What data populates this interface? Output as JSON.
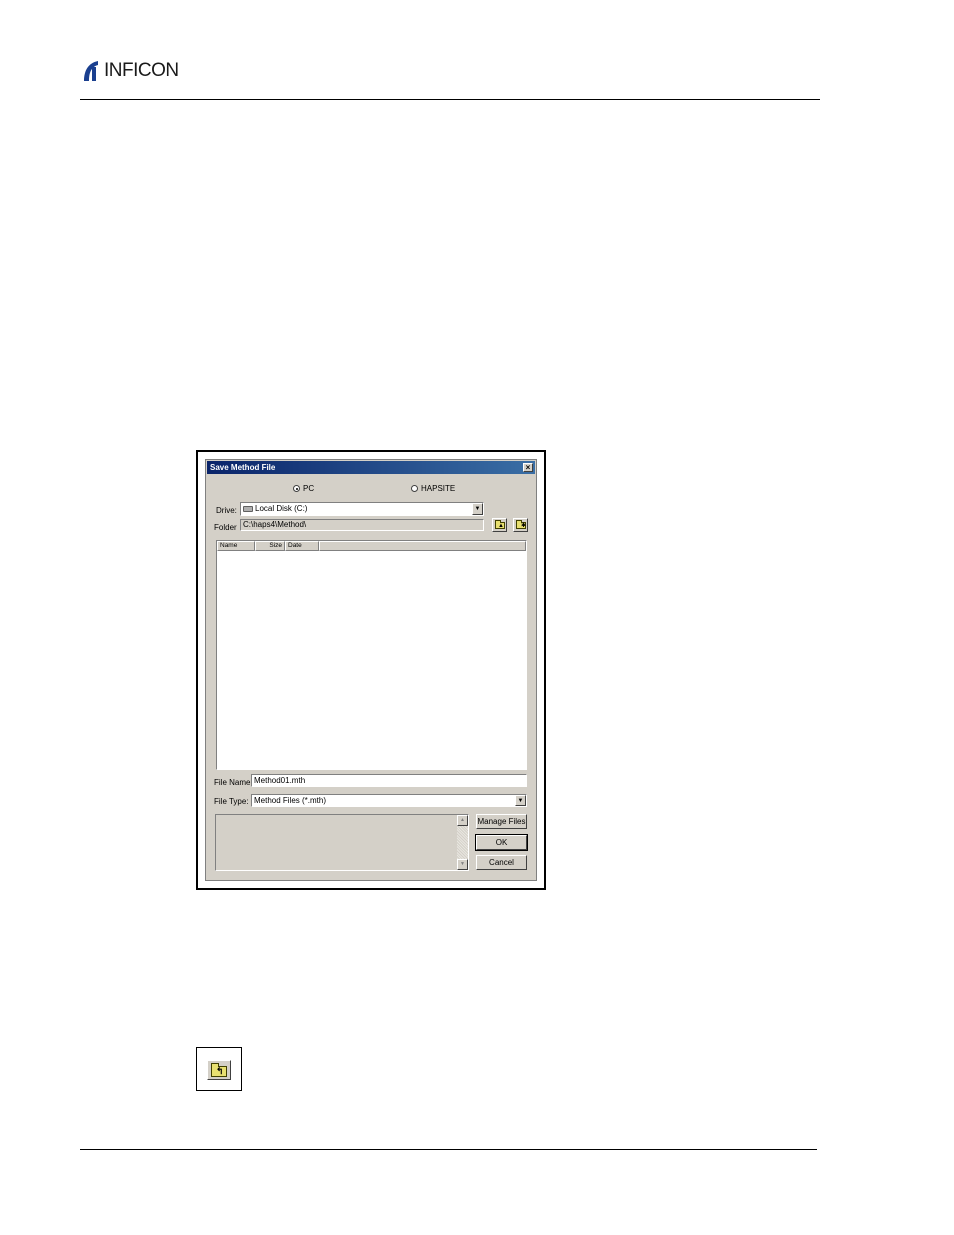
{
  "header": {
    "brand": "INFICON"
  },
  "dialog": {
    "title": "Save Method File",
    "close_label": "×",
    "location": {
      "options": [
        "PC",
        "HAPSITE"
      ],
      "selected": "PC"
    },
    "drive": {
      "label": "Drive:",
      "value": "Local Disk (C:)"
    },
    "folder": {
      "label": "Folder",
      "value": "C:\\haps4\\Method\\"
    },
    "file_list": {
      "columns": [
        "Name",
        "Size",
        "Date"
      ],
      "rows": []
    },
    "file_name": {
      "label": "File Name:",
      "value": "Method01.mth"
    },
    "file_type": {
      "label": "File Type:",
      "value": "Method Files (*.mth)"
    },
    "buttons": {
      "manage_files": "Manage Files",
      "ok": "OK",
      "cancel": "Cancel"
    },
    "icons": {
      "up_folder": "up-folder-icon",
      "new_folder": "new-folder-icon",
      "drive": "drive-icon"
    }
  },
  "colors": {
    "dialog_bg": "#d4d0c8",
    "titlebar": "#0a246a"
  }
}
